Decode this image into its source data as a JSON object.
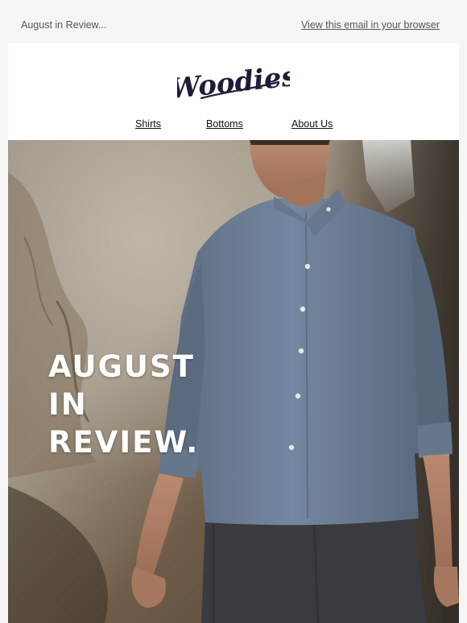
{
  "preheader": {
    "title": "August in Review...",
    "view_in_browser": "View this email in your browser"
  },
  "brand": {
    "logo_text": "Woodies",
    "logo_color": "#1c1d3a"
  },
  "nav": {
    "items": [
      {
        "label": "Shirts"
      },
      {
        "label": "Bottoms"
      },
      {
        "label": "About Us"
      }
    ]
  },
  "hero": {
    "line1": "AUGUST",
    "line2": "IN",
    "line3": "REVIEW."
  },
  "colors": {
    "background": "#f5f5f5",
    "card": "#ffffff",
    "shirt": "#6b7c92",
    "pants": "#3a3b40",
    "rock": "#8a7a66"
  }
}
